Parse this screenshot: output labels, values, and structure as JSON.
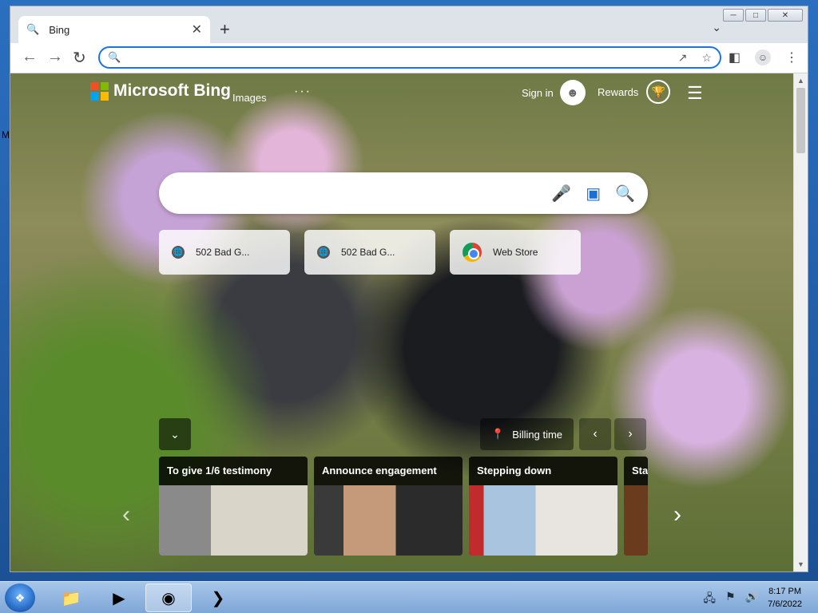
{
  "browser": {
    "tab_title": "Bing",
    "tab_close": "✕",
    "new_tab": "+",
    "omnibox_value": "",
    "omnibox_placeholder": ""
  },
  "bing": {
    "brand": "Microsoft Bing",
    "nav_images": "Images",
    "nav_more": "···",
    "sign_in": "Sign in",
    "rewards": "Rewards",
    "search_placeholder": ""
  },
  "tiles": [
    {
      "label": "502 Bad G...",
      "icon": "globe-icon"
    },
    {
      "label": "502 Bad G...",
      "icon": "globe-icon"
    },
    {
      "label": "Web Store",
      "icon": "chrome-icon"
    }
  ],
  "bottom": {
    "location": "Billing time"
  },
  "news": [
    {
      "caption": "To give 1/6 testimony"
    },
    {
      "caption": "Announce engagement"
    },
    {
      "caption": "Stepping down"
    },
    {
      "caption": "Star"
    }
  ],
  "taskbar": {
    "time": "8:17 PM",
    "date": "7/6/2022"
  },
  "colors": {
    "accent": "#1a73e8",
    "bing_blue": "#1a6fd8"
  }
}
